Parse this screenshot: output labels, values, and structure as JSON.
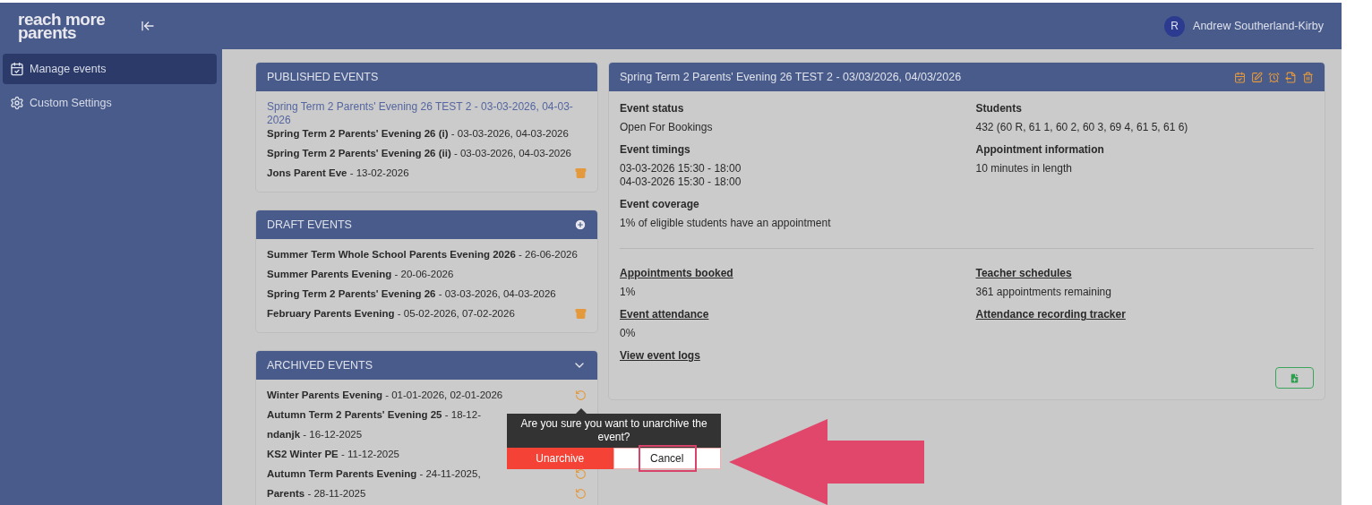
{
  "brand": {
    "logo_lines": [
      "reach more",
      "parents"
    ]
  },
  "user": {
    "initial": "R",
    "name": "Andrew Southerland-Kirby"
  },
  "sidebar": {
    "items": [
      {
        "label": "Manage events",
        "selected": true
      },
      {
        "label": "Custom Settings",
        "selected": false
      }
    ]
  },
  "panels": [
    {
      "title": "PUBLISHED EVENTS",
      "items": [
        {
          "text": "Spring Term 2 Parents' Evening 26 TEST 2 - 03-03-2026, 04-03-2026",
          "selected": true,
          "has_action": false
        },
        {
          "text": "**Spring Term 2 Parents' Evening 26 (i)** - 03-03-2026, 04-03-2026",
          "selected": false,
          "has_action": false
        },
        {
          "text": "**Spring Term 2 Parents' Evening 26 (ii)** - 03-03-2026, 04-03-2026",
          "selected": false,
          "has_action": false
        },
        {
          "text": "**Jons Parent Eve** - 13-02-2026",
          "selected": false,
          "has_action": true
        }
      ]
    },
    {
      "title": "DRAFT EVENTS",
      "items": [
        {
          "text": "**Summer Term Whole School Parents Evening 2026** - 26-06-2026",
          "selected": false,
          "has_action": false
        },
        {
          "text": "**Summer Parents Evening** - 20-06-2026",
          "selected": false,
          "has_action": false
        },
        {
          "text": "**Spring Term 2 Parents' Evening 26** - 03-03-2026, 04-03-2026",
          "selected": false,
          "has_action": false
        },
        {
          "text": "**February Parents Evening** - 05-02-2026, 07-02-2026",
          "selected": false,
          "has_action": true
        }
      ]
    },
    {
      "title": "ARCHIVED EVENTS",
      "items": [
        {
          "text": "**Winter Parents Evening** - 01-01-2026, 02-01-2026",
          "selected": false,
          "has_action": true
        },
        {
          "text": "**Autumn Term 2 Parents' Evening 25** - 18-12-",
          "selected": false,
          "has_action": false
        },
        {
          "text": "**ndanjk** - 16-12-2025",
          "selected": false,
          "has_action": false
        },
        {
          "text": "**KS2 Winter PE** - 11-12-2025",
          "selected": false,
          "has_action": false
        },
        {
          "text": "**Autumn Term Parents Evening** - 24-11-2025,",
          "selected": false,
          "has_action": true
        },
        {
          "text": "**Parents** - 28-11-2025",
          "selected": false,
          "has_action": true
        }
      ]
    }
  ],
  "detail": {
    "title": "Spring Term 2 Parents' Evening 26 TEST 2 - 03/03/2026, 04/03/2026",
    "summary": [
      {
        "label": "Event status",
        "lines": [
          "Open For Bookings"
        ]
      },
      {
        "label": "Students",
        "lines": [
          "432 (60 R, 61 1, 60 2, 60 3, 69 4, 61 5, 61 6)"
        ]
      },
      {
        "label": "Event timings",
        "lines": [
          "03-03-2026 15:30 - 18:00",
          "04-03-2026 15:30 - 18:00"
        ]
      },
      {
        "label": "Appointment information",
        "lines": [
          "10 minutes in length"
        ]
      },
      {
        "label": "Event coverage",
        "lines": [
          "1% of eligible students have an appointment"
        ]
      }
    ],
    "stats": [
      {
        "label": "Appointments booked",
        "lines": [
          "1%"
        ]
      },
      {
        "label": "Teacher schedules",
        "lines": [
          "361 appointments remaining"
        ]
      },
      {
        "label": "Event attendance",
        "lines": [
          "0%"
        ]
      },
      {
        "label": "Attendance recording tracker"
      },
      {
        "label": "View event logs"
      }
    ]
  },
  "popconfirm": {
    "message": "Are you sure you want to unarchive the event?",
    "confirm": "Unarchive",
    "cancel": "Cancel"
  }
}
